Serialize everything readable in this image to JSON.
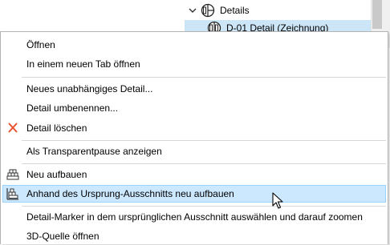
{
  "navigator": {
    "details_label": "Details",
    "sub_label": "D-01 Detail (Zeichnung)"
  },
  "menu": {
    "open": "Öffnen",
    "open_new_tab": "In einem neuen Tab öffnen",
    "new_independent_detail": "Neues unabhängiges Detail...",
    "rename_detail": "Detail umbenennen...",
    "delete_detail": "Detail löschen",
    "show_as_trace": "Als Transparentpause anzeigen",
    "rebuild": "Neu aufbauen",
    "rebuild_from_source": "Anhand des Ursprung-Ausschnitts neu aufbauen",
    "select_marker": "Detail-Marker in dem ursprünglichen Ausschnitt auswählen und darauf zoomen",
    "open_3d_source": "3D-Quelle öffnen"
  },
  "colors": {
    "highlight_bg": "#cce8ff",
    "highlight_border": "#99d1ff",
    "delete_icon": "#e8542f",
    "selected_tree_row": "#cde6f7"
  },
  "icons": {
    "tree_chevron": "chevron-down-icon",
    "tree_details": "detail-marker-icon",
    "tree_sub": "detail-view-icon",
    "delete": "close-icon",
    "rebuild": "rebuild-icon",
    "rebuild_source": "rebuild-from-source-icon",
    "cursor": "mouse-pointer-icon"
  }
}
